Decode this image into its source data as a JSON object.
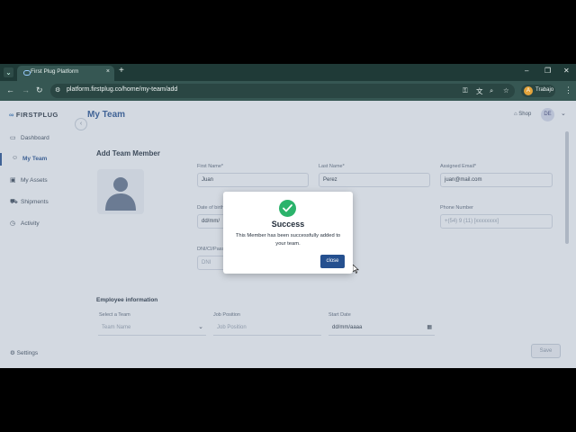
{
  "browser": {
    "tab_title": "First Plug Platform",
    "url": "platform.firstplug.co/home/my-team/add",
    "profile_initial": "A",
    "profile_name": "Trabajo",
    "new_tab": "+",
    "tab_close": "×"
  },
  "app": {
    "logo_text": "FIRSTPLUG",
    "page_title": "My Team",
    "shop_label": "Shop",
    "avatar_initials": "DE",
    "sidebar": {
      "items": [
        {
          "label": "Dashboard",
          "icon": "dashboard-icon"
        },
        {
          "label": "My Team",
          "icon": "team-icon"
        },
        {
          "label": "My Assets",
          "icon": "laptop-icon"
        },
        {
          "label": "Shipments",
          "icon": "truck-icon"
        },
        {
          "label": "Activity",
          "icon": "clock-icon"
        }
      ],
      "settings": "Settings"
    }
  },
  "form": {
    "section_title": "Add Team Member",
    "first_name": {
      "label": "First Name*",
      "value": "Juan"
    },
    "last_name": {
      "label": "Last Name*",
      "value": "Perez"
    },
    "email": {
      "label": "Assigned Email*",
      "value": "juan@mail.com"
    },
    "dob": {
      "label": "Date of birth",
      "value": "dd/mm/"
    },
    "phone": {
      "label": "Phone Number",
      "placeholder": "+(54) 9 (11) [xxxxxxxx]"
    },
    "dni": {
      "label": "DNI/CI/Pass",
      "placeholder": "DNI"
    },
    "employee_title": "Employee information",
    "team": {
      "label": "Select a Team",
      "placeholder": "Team Name"
    },
    "position": {
      "label": "Job Position",
      "placeholder": "Job Position"
    },
    "start_date": {
      "label": "Start Date",
      "value": "dd/mm/aaaa"
    },
    "save_label": "Save"
  },
  "modal": {
    "title": "Success",
    "message": "This Member has been successfully added to your team.",
    "close_label": "close",
    "accent": "#2bb36b",
    "button_color": "#25508f"
  }
}
